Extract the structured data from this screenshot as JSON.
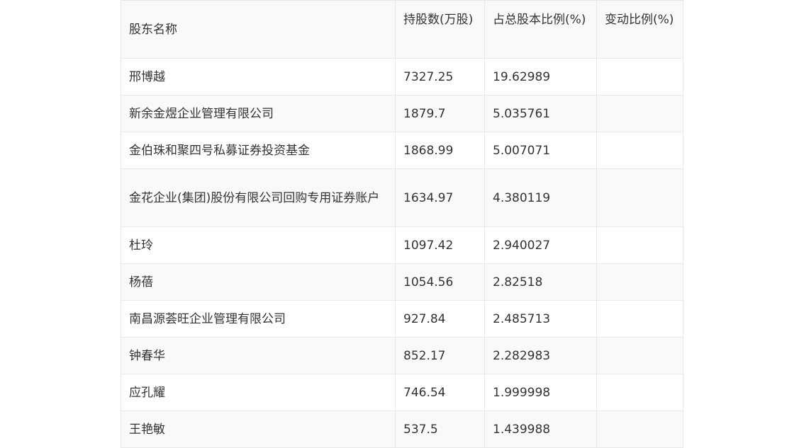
{
  "table": {
    "headers": [
      "股东名称",
      "持股数(万股)",
      "占总股本比例(%)",
      "变动比例(%)"
    ],
    "rows": [
      [
        "邢博越",
        "7327.25",
        "19.62989",
        ""
      ],
      [
        "新余金煜企业管理有限公司",
        "1879.7",
        "5.035761",
        ""
      ],
      [
        "金伯珠和聚四号私募证券投资基金",
        "1868.99",
        "5.007071",
        ""
      ],
      [
        "金花企业(集团)股份有限公司回购专用证券账户",
        "1634.97",
        "4.380119",
        ""
      ],
      [
        "杜玲",
        "1097.42",
        "2.940027",
        ""
      ],
      [
        "杨蓓",
        "1054.56",
        "2.82518",
        ""
      ],
      [
        "南昌源荟旺企业管理有限公司",
        "927.84",
        "2.485713",
        ""
      ],
      [
        "钟春华",
        "852.17",
        "2.282983",
        ""
      ],
      [
        "应孔耀",
        "746.54",
        "1.999998",
        ""
      ],
      [
        "王艳敏",
        "537.5",
        "1.439988",
        ""
      ]
    ]
  }
}
